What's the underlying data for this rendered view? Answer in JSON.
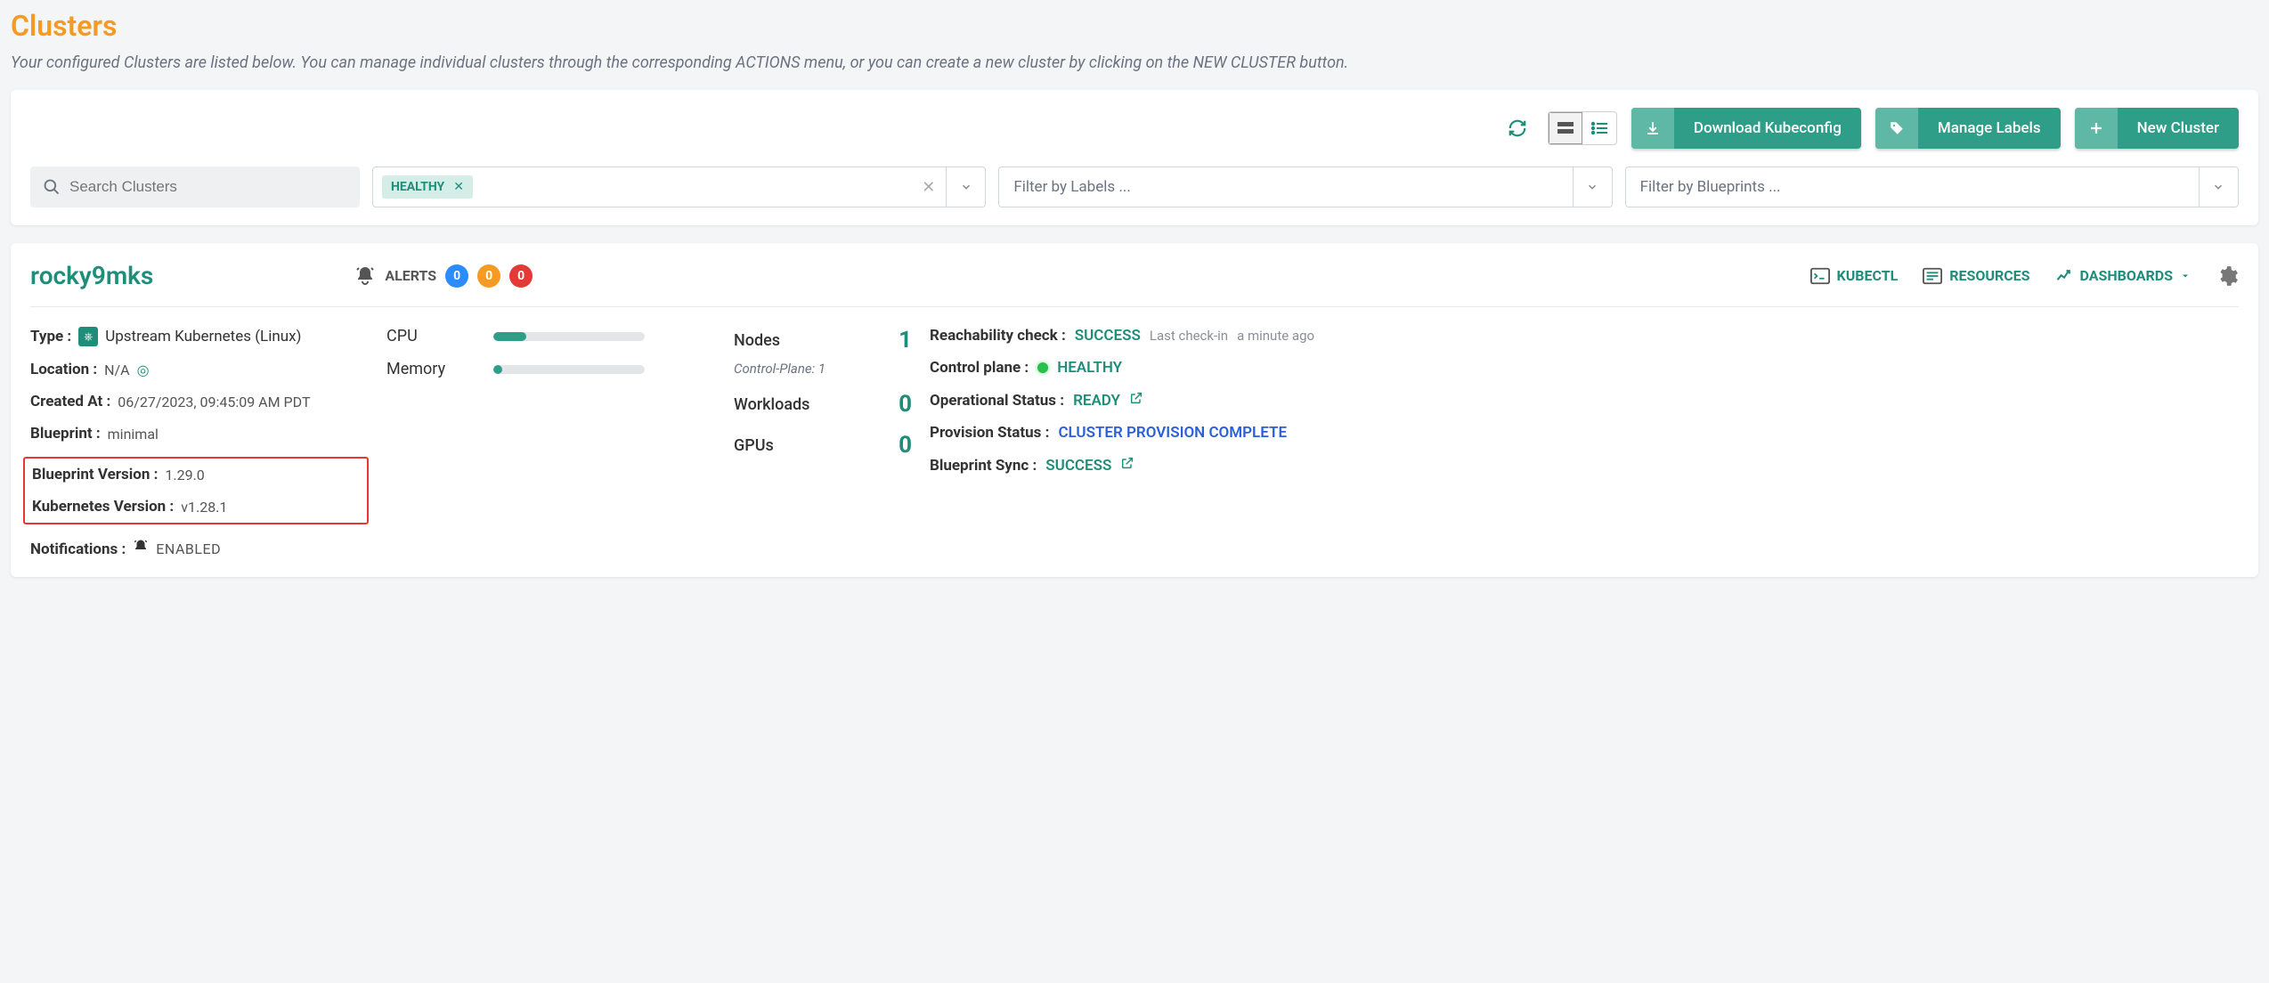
{
  "page": {
    "title": "Clusters",
    "subtitle": "Your configured Clusters are listed below. You can manage individual clusters through the corresponding ACTIONS menu, or you can create a new cluster by clicking on the NEW CLUSTER button."
  },
  "toolbar": {
    "download_label": "Download Kubeconfig",
    "manage_labels_label": "Manage Labels",
    "new_cluster_label": "New Cluster",
    "search_placeholder": "Search Clusters",
    "status_filter_chip": "HEALTHY",
    "labels_filter_placeholder": "Filter by Labels ...",
    "blueprints_filter_placeholder": "Filter by Blueprints ..."
  },
  "cluster": {
    "name": "rocky9mks",
    "alerts_label": "ALERTS",
    "alerts": {
      "info": "0",
      "warn": "0",
      "crit": "0"
    },
    "links": {
      "kubectl": "KUBECTL",
      "resources": "RESOURCES",
      "dashboards": "DASHBOARDS"
    },
    "details": {
      "type_label": "Type :",
      "type_value": "Upstream Kubernetes (Linux)",
      "location_label": "Location :",
      "location_value": "N/A",
      "created_label": "Created At :",
      "created_value": "06/27/2023, 09:45:09 AM PDT",
      "blueprint_label": "Blueprint :",
      "blueprint_value": "minimal",
      "blueprint_version_label": "Blueprint Version :",
      "blueprint_version_value": "1.29.0",
      "k8s_version_label": "Kubernetes Version :",
      "k8s_version_value": "v1.28.1",
      "notifications_label": "Notifications :",
      "notifications_value": "ENABLED"
    },
    "resources": {
      "cpu_label": "CPU",
      "cpu_pct": 22,
      "memory_label": "Memory",
      "memory_pct": 6
    },
    "metrics": {
      "nodes_label": "Nodes",
      "nodes_value": "1",
      "nodes_sub": "Control-Plane: 1",
      "workloads_label": "Workloads",
      "workloads_value": "0",
      "gpus_label": "GPUs",
      "gpus_value": "0"
    },
    "status": {
      "reach_label": "Reachability check :",
      "reach_value": "SUCCESS",
      "reach_sub1": "Last check-in",
      "reach_sub2": "a minute ago",
      "cp_label": "Control plane :",
      "cp_value": "HEALTHY",
      "op_label": "Operational Status :",
      "op_value": "READY",
      "prov_label": "Provision Status :",
      "prov_value": "CLUSTER PROVISION COMPLETE",
      "bp_sync_label": "Blueprint Sync :",
      "bp_sync_value": "SUCCESS"
    }
  }
}
